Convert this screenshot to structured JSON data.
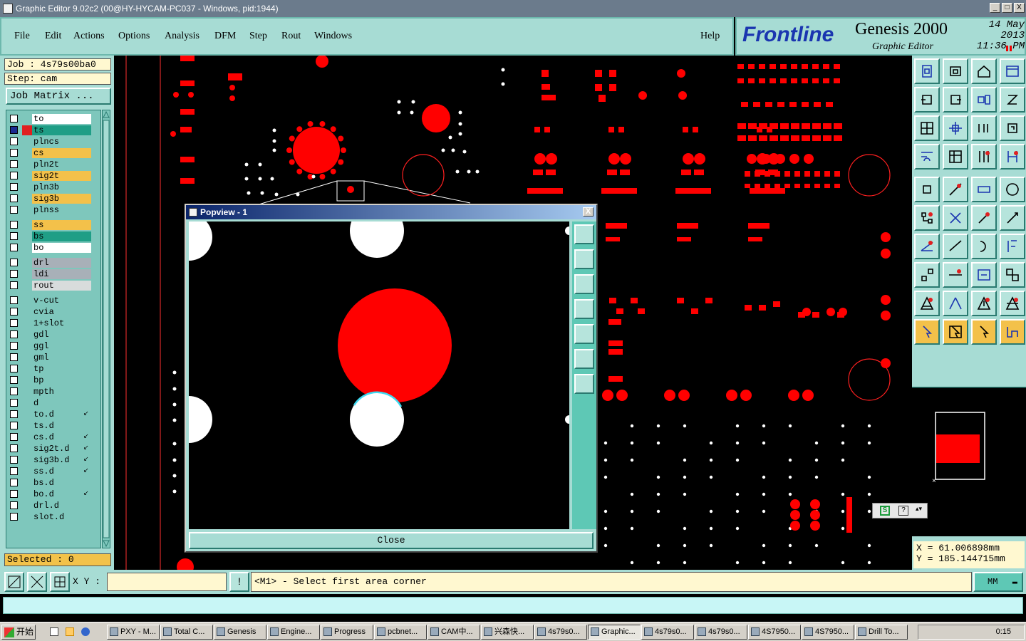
{
  "window": {
    "title": "Graphic Editor 9.02c2 (00@HY-HYCAM-PC037 - Windows, pid:1944)",
    "min": "_",
    "max": "□",
    "close": "X"
  },
  "menu": {
    "items": [
      "File",
      "Edit",
      "Actions",
      "Options",
      "Analysis",
      "DFM",
      "Step",
      "Rout",
      "Windows"
    ],
    "help": "Help"
  },
  "brand": {
    "logo": "Frontline",
    "product": "Genesis 2000",
    "subtitle": "Graphic Editor",
    "date": "14 May 2013",
    "time": "11:36 PM"
  },
  "job": {
    "job_line": "Job : 4s79s00ba0",
    "step_line": "Step: cam",
    "matrix_button": "Job Matrix ..."
  },
  "layers": [
    {
      "name": "to",
      "color": "#ffffff",
      "checked": false
    },
    {
      "name": "ts",
      "color": "#1f9e86",
      "checked": true,
      "swatch": "#e02020"
    },
    {
      "name": "plncs",
      "color": "#7ec7bc",
      "checked": false
    },
    {
      "name": "cs",
      "color": "#f3c14a",
      "checked": false
    },
    {
      "name": "pln2t",
      "color": "#7ec7bc",
      "checked": false
    },
    {
      "name": "sig2t",
      "color": "#f3c14a",
      "checked": false
    },
    {
      "name": "pln3b",
      "color": "#7ec7bc",
      "checked": false
    },
    {
      "name": "sig3b",
      "color": "#f3c14a",
      "checked": false
    },
    {
      "name": "plnss",
      "color": "#7ec7bc",
      "checked": false
    },
    {
      "name": "ss",
      "color": "#f3c14a",
      "checked": false
    },
    {
      "name": "bs",
      "color": "#1f9e86",
      "checked": false
    },
    {
      "name": "bo",
      "color": "#ffffff",
      "checked": false
    },
    {
      "name": "drl",
      "color": "#a8b0b8",
      "checked": false
    },
    {
      "name": "ldi",
      "color": "#a8b0b8",
      "checked": false
    },
    {
      "name": "rout",
      "color": "#d8dcdc",
      "checked": false
    },
    {
      "name": "v-cut",
      "color": "#7ec7bc",
      "checked": false
    },
    {
      "name": "cvia",
      "color": "#7ec7bc",
      "checked": false
    },
    {
      "name": "1+slot",
      "color": "#7ec7bc",
      "checked": false
    },
    {
      "name": "gdl",
      "color": "#7ec7bc",
      "checked": false
    },
    {
      "name": "ggl",
      "color": "#7ec7bc",
      "checked": false
    },
    {
      "name": "gml",
      "color": "#7ec7bc",
      "checked": false
    },
    {
      "name": "tp",
      "color": "#7ec7bc",
      "checked": false
    },
    {
      "name": "bp",
      "color": "#7ec7bc",
      "checked": false
    },
    {
      "name": "mpth",
      "color": "#7ec7bc",
      "checked": false
    },
    {
      "name": "d",
      "color": "#7ec7bc",
      "checked": false
    },
    {
      "name": "to.d",
      "color": "#7ec7bc",
      "checked": false,
      "mark": "↙"
    },
    {
      "name": "ts.d",
      "color": "#7ec7bc",
      "checked": false
    },
    {
      "name": "cs.d",
      "color": "#7ec7bc",
      "checked": false,
      "mark": "↙"
    },
    {
      "name": "sig2t.d",
      "color": "#7ec7bc",
      "checked": false,
      "mark": "↙"
    },
    {
      "name": "sig3b.d",
      "color": "#7ec7bc",
      "checked": false,
      "mark": "↙"
    },
    {
      "name": "ss.d",
      "color": "#7ec7bc",
      "checked": false,
      "mark": "↙"
    },
    {
      "name": "bs.d",
      "color": "#7ec7bc",
      "checked": false
    },
    {
      "name": "bo.d",
      "color": "#7ec7bc",
      "checked": false,
      "mark": "↙"
    },
    {
      "name": "drl.d",
      "color": "#7ec7bc",
      "checked": false
    },
    {
      "name": "slot.d",
      "color": "#7ec7bc",
      "checked": false
    }
  ],
  "selected": "Selected : 0",
  "popview": {
    "title": "Popview - 1",
    "close_button": "Close",
    "close_x": "X"
  },
  "status": {
    "xy_label": "X Y :",
    "xy_value": "",
    "message": "<M1> - Select first area corner",
    "units": "MM",
    "bang": "!"
  },
  "coords": {
    "x": "X  =  61.006898mm",
    "y": "Y  =  185.144715mm"
  },
  "taskbar": {
    "start": "开始",
    "tasks": [
      "PXY - M...",
      "Total C...",
      "Genesis",
      "Engine...",
      "Progress",
      "pcbnet...",
      "CAM中...",
      "兴森快...",
      "4s79s0...",
      "Graphic...",
      "4s79s0...",
      "4s79s0...",
      "4S7950...",
      "4S7950...",
      "Drill To..."
    ],
    "active_index": 9,
    "clock": "0:15"
  },
  "colors": {
    "accent": "#a7dcd4",
    "copper": "#ff0000",
    "drill": "#ffffff"
  }
}
